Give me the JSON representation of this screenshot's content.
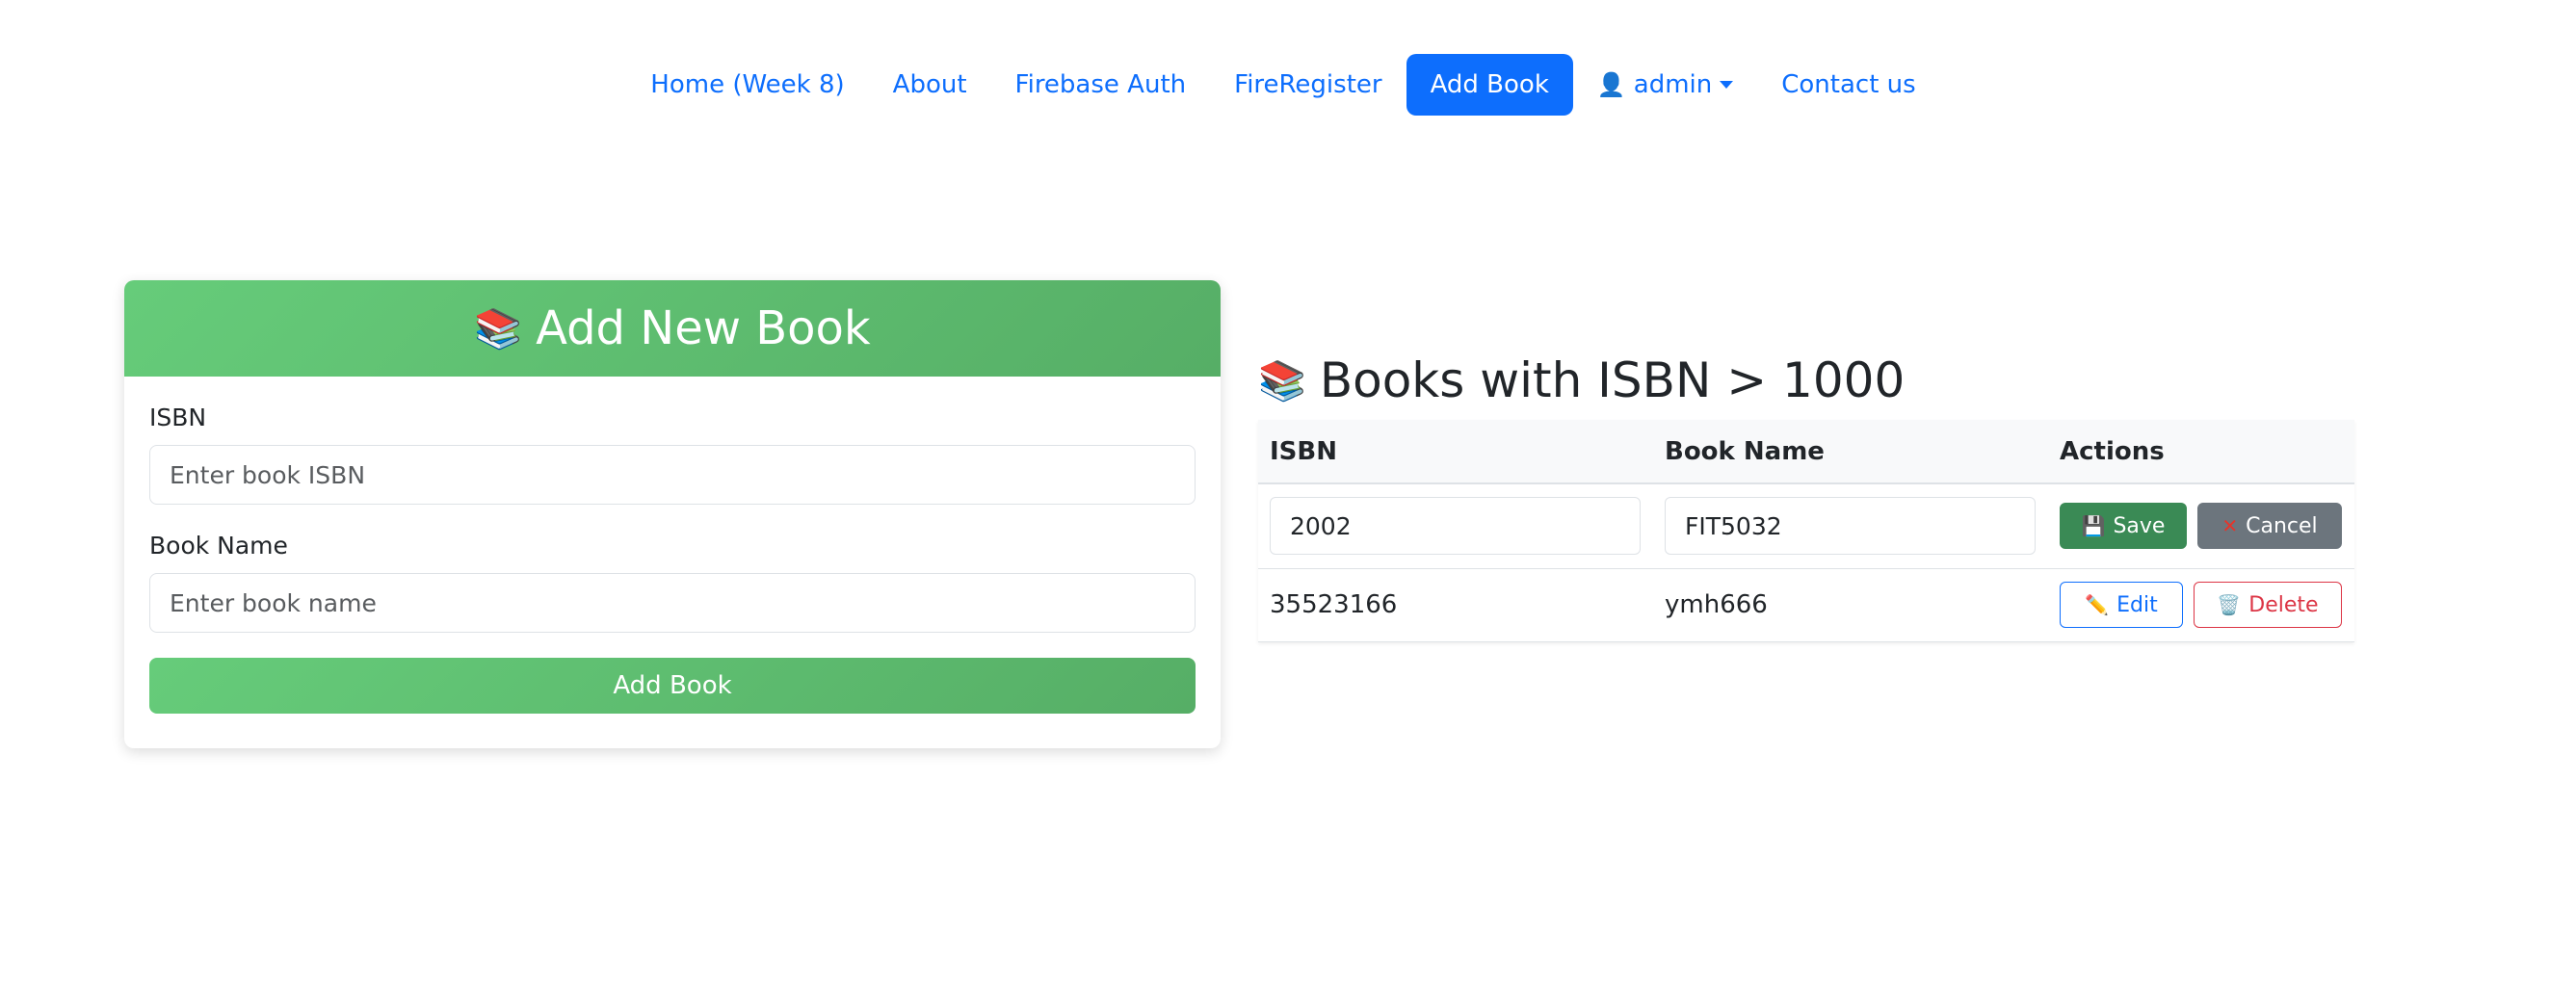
{
  "nav": {
    "items": [
      {
        "label": "Home (Week 8)",
        "active": false
      },
      {
        "label": "About",
        "active": false
      },
      {
        "label": "Firebase Auth",
        "active": false
      },
      {
        "label": "FireRegister",
        "active": false
      },
      {
        "label": "Add Book",
        "active": true
      }
    ],
    "user": {
      "icon": "user-icon",
      "label": "admin"
    },
    "contact": "Contact us"
  },
  "add_form": {
    "emoji": "📚",
    "title": "Add New Book",
    "isbn_label": "ISBN",
    "isbn_placeholder": "Enter book ISBN",
    "name_label": "Book Name",
    "name_placeholder": "Enter book name",
    "submit": "Add Book"
  },
  "list": {
    "emoji": "📚",
    "title": "Books with ISBN > 1000",
    "headers": [
      "ISBN",
      "Book Name",
      "Actions"
    ],
    "edit_row": {
      "isbn": "2002",
      "name": "FIT5032",
      "save": "Save",
      "cancel": "Cancel"
    },
    "rows": [
      {
        "isbn": "35523166",
        "name": "ymh666",
        "edit": "Edit",
        "delete": "Delete"
      }
    ]
  },
  "colors": {
    "primary": "#0d6efd",
    "green": "#5cb96f",
    "save": "#3a8a55",
    "cancel": "#6c757d",
    "danger": "#dc3545"
  }
}
